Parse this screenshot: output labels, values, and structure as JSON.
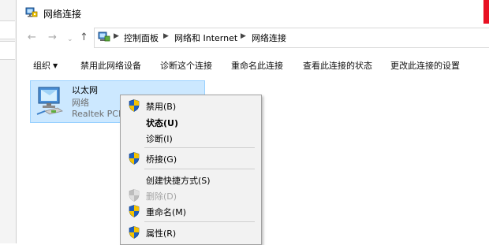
{
  "window": {
    "title": "网络连接"
  },
  "nav": {
    "back": "←",
    "forward": "→",
    "dropdown": "⌄",
    "up": "↑"
  },
  "address": {
    "crumbs": [
      "控制面板",
      "网络和 Internet",
      "网络连接"
    ]
  },
  "toolbar": {
    "items": [
      "组织",
      "禁用此网络设备",
      "诊断这个连接",
      "重命名此连接",
      "查看此连接的状态",
      "更改此连接的设置"
    ]
  },
  "connection": {
    "name": "以太网",
    "network": "网络",
    "device": "Realtek PCIe"
  },
  "context_menu": {
    "items": [
      {
        "label": "禁用(B)",
        "shield": true,
        "bold": false,
        "disabled": false
      },
      {
        "label": "状态(U)",
        "shield": false,
        "bold": true,
        "disabled": false
      },
      {
        "label": "诊断(I)",
        "shield": false,
        "bold": false,
        "disabled": false
      },
      {
        "label": "桥接(G)",
        "shield": true,
        "bold": false,
        "disabled": false
      },
      {
        "label": "创建快捷方式(S)",
        "shield": false,
        "bold": false,
        "disabled": false
      },
      {
        "label": "删除(D)",
        "shield": true,
        "bold": false,
        "disabled": true
      },
      {
        "label": "重命名(M)",
        "shield": true,
        "bold": false,
        "disabled": false
      },
      {
        "label": "属性(R)",
        "shield": true,
        "bold": false,
        "disabled": false
      }
    ]
  },
  "icons": {
    "app": "network-connections-icon",
    "shield": "uac-shield-icon",
    "ethernet": "ethernet-adapter-icon"
  },
  "colors": {
    "selection_bg": "#cce8ff",
    "selection_border": "#99d1ff",
    "menu_bg": "#f2f2f2",
    "close_red": "#e81123"
  }
}
